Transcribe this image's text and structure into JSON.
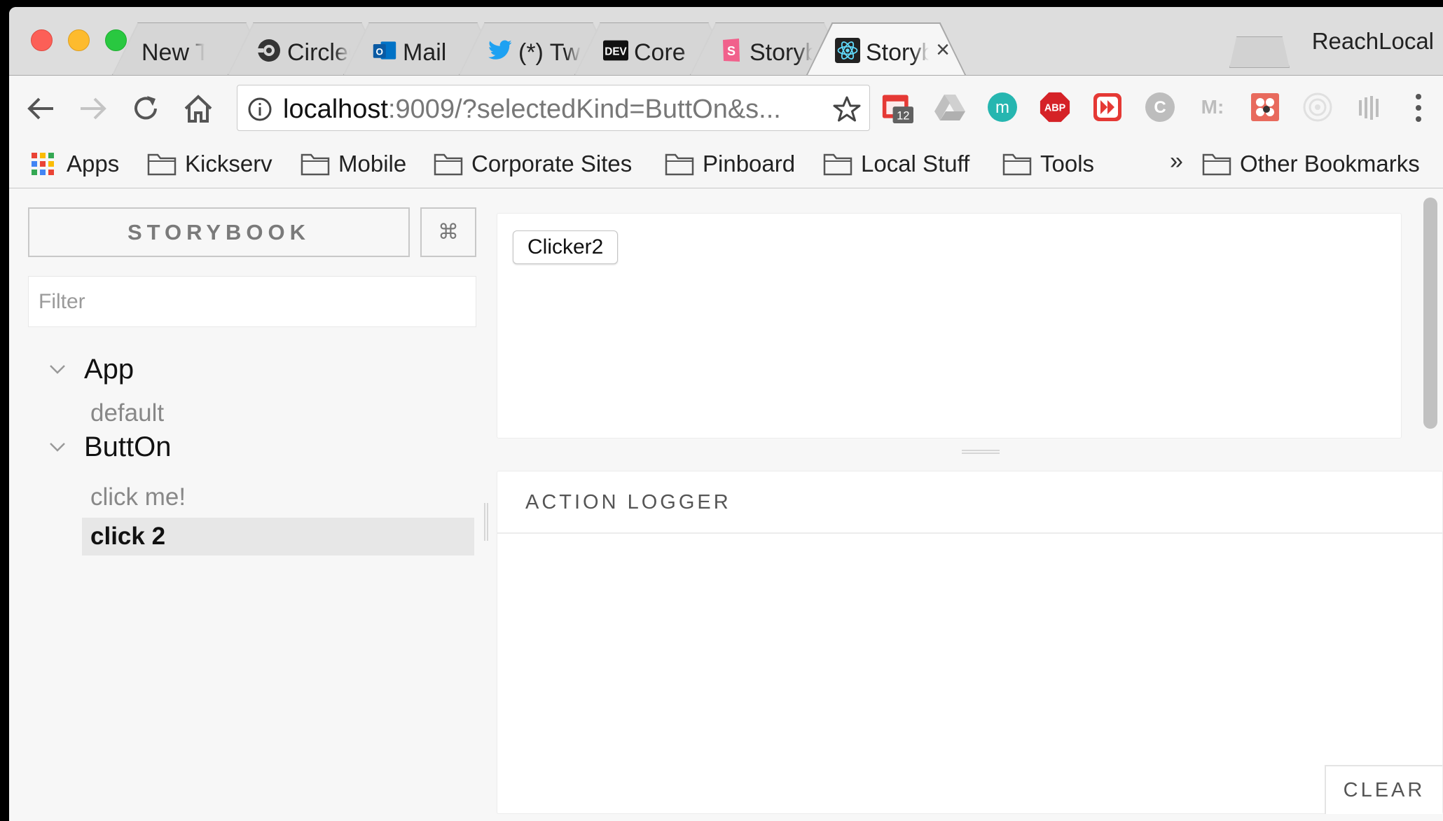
{
  "browser": {
    "profile_name": "ReachLocal",
    "tabs": [
      {
        "title": "New Tab",
        "icon": "new-tab-icon"
      },
      {
        "title": "CircleCI",
        "icon": "circleci-icon"
      },
      {
        "title": "Mail",
        "icon": "outlook-icon"
      },
      {
        "title": "(*) Twitter",
        "icon": "twitter-icon"
      },
      {
        "title": "Core",
        "icon": "dev-icon"
      },
      {
        "title": "Storybook",
        "icon": "storybook-icon"
      },
      {
        "title": "Storybook",
        "icon": "react-icon",
        "active": true
      }
    ],
    "address": {
      "host": "localhost",
      "path": ":9009/?selectedKind=ButtOn&s..."
    },
    "extensions": [
      {
        "name": "calendar-extension-icon",
        "badge": "12"
      },
      {
        "name": "drive-extension-icon"
      },
      {
        "name": "m-extension-icon",
        "label": "m"
      },
      {
        "name": "adblock-plus-icon",
        "label": "ABP"
      },
      {
        "name": "forward-extension-icon"
      },
      {
        "name": "c-extension-icon",
        "label": "C"
      },
      {
        "name": "m-colon-extension-icon",
        "label": "M:"
      },
      {
        "name": "bug-extension-icon"
      },
      {
        "name": "target-extension-icon"
      },
      {
        "name": "bars-extension-icon"
      }
    ],
    "bookmarks": [
      {
        "label": "Apps",
        "icon": "apps-grid-icon"
      },
      {
        "label": "Kickserv",
        "icon": "folder-icon"
      },
      {
        "label": "Mobile",
        "icon": "folder-icon"
      },
      {
        "label": "Corporate Sites",
        "icon": "folder-icon"
      },
      {
        "label": "Pinboard",
        "icon": "folder-icon"
      },
      {
        "label": "Local Stuff",
        "icon": "folder-icon"
      },
      {
        "label": "Tools",
        "icon": "folder-icon"
      }
    ],
    "bookmarks_overflow": "»",
    "other_bookmarks": "Other Bookmarks"
  },
  "storybook": {
    "title": "STORYBOOK",
    "shortcuts_label": "⌘",
    "filter_placeholder": "Filter",
    "kinds": [
      {
        "name": "App",
        "stories": [
          "default"
        ]
      },
      {
        "name": "ButtOn",
        "stories": [
          "click me!",
          "click 2"
        ]
      }
    ],
    "selected_story": "click 2",
    "preview_button_label": "Clicker2",
    "action_logger": {
      "title": "ACTION LOGGER",
      "clear_label": "CLEAR"
    }
  },
  "colors": {
    "react": "#61dafb",
    "twitter": "#1da1f2",
    "outlook": "#0072c6",
    "storybook_pink": "#f1618c",
    "abp_red": "#d52227"
  }
}
